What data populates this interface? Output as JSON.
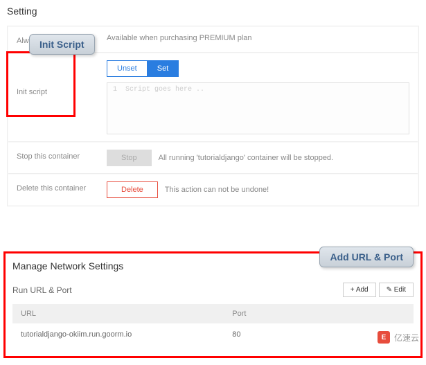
{
  "setting": {
    "title": "Setting",
    "always_on": {
      "label": "Always-on",
      "text": "Available when purchasing PREMIUM plan"
    },
    "init_script": {
      "label": "Init script",
      "unset": "Unset",
      "set": "Set",
      "placeholder": "Script goes here ..",
      "line_num": "1",
      "callout": "Init Script"
    },
    "stop": {
      "label": "Stop this container",
      "button": "Stop",
      "text": "All running 'tutorialdjango' container will be stopped."
    },
    "delete": {
      "label": "Delete this container",
      "button": "Delete",
      "text": "This action can not be undone!"
    }
  },
  "network": {
    "title": "Manage Network Settings",
    "callout": "Add URL & Port",
    "subtitle": "Run URL & Port",
    "add_btn": "+ Add",
    "edit_btn": "✎ Edit",
    "headers": {
      "url": "URL",
      "port": "Port"
    },
    "row": {
      "url": "tutorialdjango-okiim.run.goorm.io",
      "port": "80"
    }
  },
  "watermark": {
    "icon": "E",
    "text": "亿速云"
  }
}
